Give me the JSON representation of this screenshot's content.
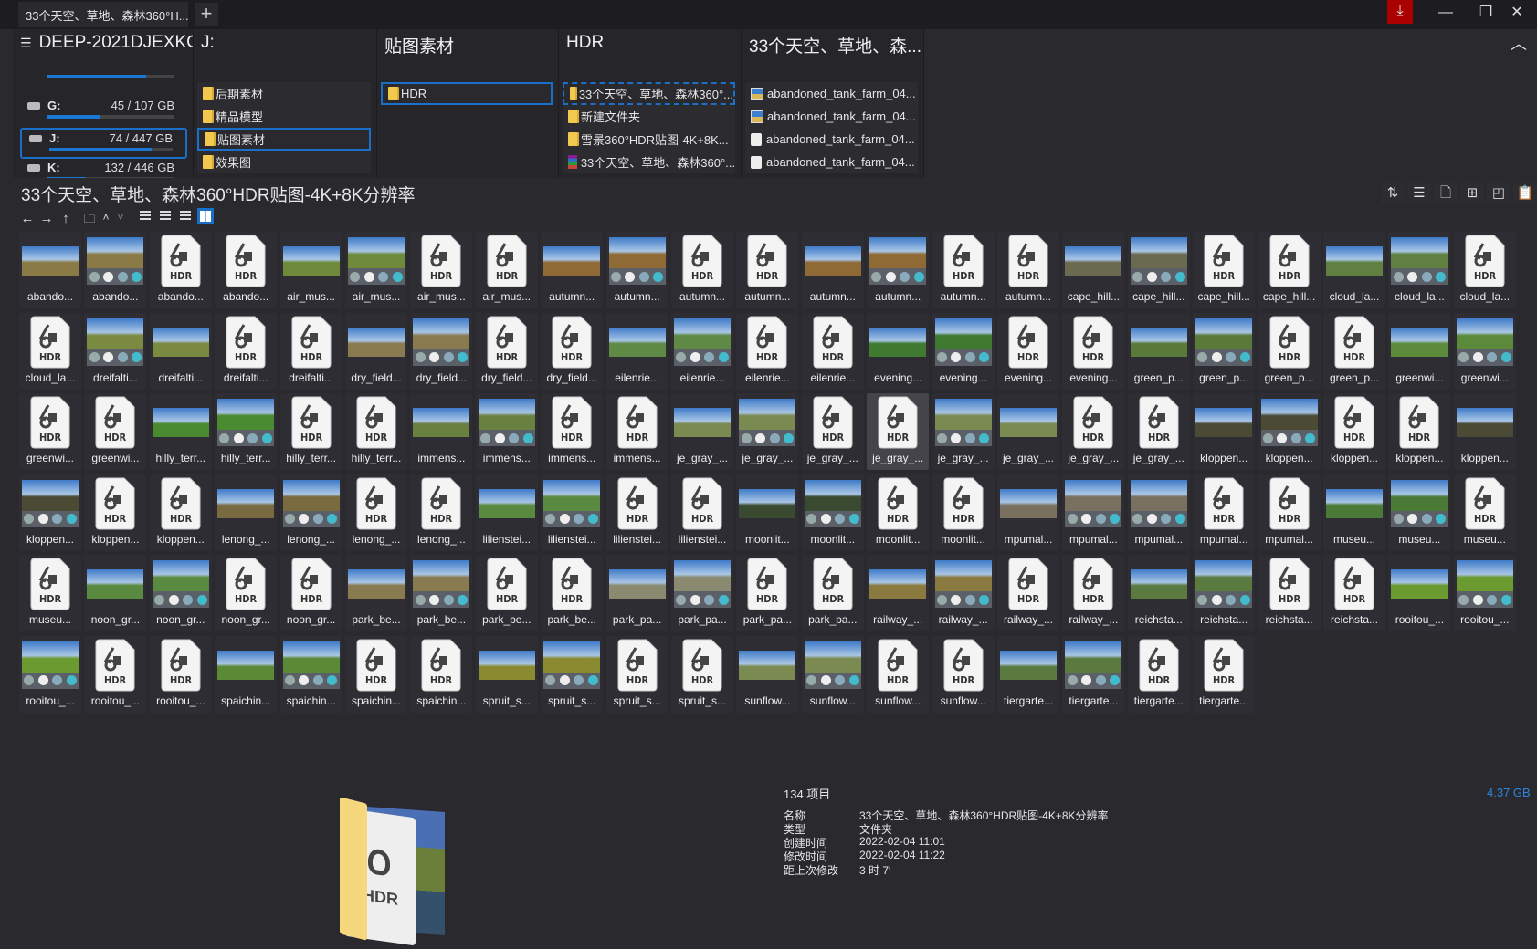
{
  "tab": {
    "title": "33个天空、草地、森林360°H...",
    "new_tab": "+"
  },
  "window": {
    "download": "⤓",
    "minimize": "—",
    "restore": "❐",
    "close": "✕",
    "collapse": "︿"
  },
  "columns": [
    {
      "header": "DEEP-2021DJEXKC",
      "menu_icon": "☰",
      "drives": [
        {
          "name": "G:",
          "size": "45 / 107 GB",
          "used": 0.42
        },
        {
          "name": "J:",
          "size": "74 / 447 GB",
          "used": 0.83,
          "selected": true
        },
        {
          "name": "K:",
          "size": "132 / 446 GB",
          "used": 0.3
        }
      ]
    },
    {
      "header": "J:",
      "items": [
        {
          "label": "后期素材"
        },
        {
          "label": "精品模型"
        },
        {
          "label": "贴图素材",
          "selected": true
        },
        {
          "label": "效果图"
        }
      ]
    },
    {
      "header": "贴图素材",
      "items": [
        {
          "label": "HDR",
          "selected": true
        }
      ]
    },
    {
      "header": "HDR",
      "items": [
        {
          "label": "33个天空、草地、森林360°...",
          "selected": true,
          "icon": "folder"
        },
        {
          "label": "新建文件夹",
          "icon": "folder"
        },
        {
          "label": "雪景360°HDR贴图-4K+8K...",
          "icon": "folder"
        },
        {
          "label": "33个天空、草地、森林360°...",
          "icon": "archive"
        }
      ]
    },
    {
      "header": "33个天空、草地、森...",
      "items": [
        {
          "label": "abandoned_tank_farm_04...",
          "icon": "image"
        },
        {
          "label": "abandoned_tank_farm_04...",
          "icon": "image"
        },
        {
          "label": "abandoned_tank_farm_04...",
          "icon": "hdr-file"
        },
        {
          "label": "abandoned_tank_farm_04...",
          "icon": "hdr-file"
        }
      ]
    }
  ],
  "folder_title": "33个天空、草地、森林360°HDR贴图-4K+8K分辨率",
  "nav_tools": [
    "←",
    "→",
    "↑",
    "🗀",
    "˄",
    "˅"
  ],
  "view_tools": [
    "details",
    "tiles",
    "list",
    "icons"
  ],
  "active_view": "icons",
  "right_tools": [
    "⇅",
    "☰",
    "🗋",
    "⊞",
    "◰",
    "📋"
  ],
  "hdr_label": "HDR",
  "accent": "#1a6fc9",
  "ground_colors": {
    "abando...": "#8a7a45",
    "air_mus...": "#6f8a3a",
    "autumn...": "#8f6a35",
    "cape_hill...": "#6a6a50",
    "cloud_la...": "#5f8040",
    "dreifalti...": "#7a8a40",
    "dry_field...": "#8a7a50",
    "eilenrie...": "#5f8a45",
    "evening...": "#3f7a30",
    "green_p...": "#5a7a3a",
    "greenwi...": "#5a8a3a",
    "hilly_terr...": "#4a8a30",
    "immens...": "#6a8040",
    "je_gray_...": "#7a8a50",
    "kloppen...": "#4a4a35",
    "lenong_...": "#7a6a40",
    "lilienstei...": "#5a8a40",
    "moonlit...": "#3a4a30",
    "mpumal...": "#7a7060",
    "museu...": "#4a7a35",
    "noon_gr...": "#5a8a40",
    "park_be...": "#8a7a50",
    "park_pa...": "#8a8a70",
    "railway_...": "#8a7a40",
    "reichsta...": "#5a7a40",
    "rooitou_...": "#6a9a30",
    "spaichin...": "#5a8a35",
    "spruit_s...": "#8a8a30",
    "sunflow...": "#7a8a50",
    "tiergarte...": "#5a7a40"
  },
  "selected_file_index": 59,
  "files": [
    [
      "abando...",
      "w"
    ],
    [
      "abando...",
      "s"
    ],
    [
      "abando...",
      "h"
    ],
    [
      "abando...",
      "h"
    ],
    [
      "air_mus...",
      "w"
    ],
    [
      "air_mus...",
      "s"
    ],
    [
      "air_mus...",
      "h"
    ],
    [
      "air_mus...",
      "h"
    ],
    [
      "autumn...",
      "w"
    ],
    [
      "autumn...",
      "s"
    ],
    [
      "autumn...",
      "h"
    ],
    [
      "autumn...",
      "h"
    ],
    [
      "autumn...",
      "w"
    ],
    [
      "autumn...",
      "s"
    ],
    [
      "autumn...",
      "h"
    ],
    [
      "autumn...",
      "h"
    ],
    [
      "cape_hill...",
      "w"
    ],
    [
      "cape_hill...",
      "s"
    ],
    [
      "cape_hill...",
      "h"
    ],
    [
      "cape_hill...",
      "h"
    ],
    [
      "cloud_la...",
      "w"
    ],
    [
      "cloud_la...",
      "s"
    ],
    [
      "cloud_la...",
      "h"
    ],
    [
      "cloud_la...",
      "h"
    ],
    [
      "dreifalti...",
      "s"
    ],
    [
      "dreifalti...",
      "w"
    ],
    [
      "dreifalti...",
      "h"
    ],
    [
      "dreifalti...",
      "h"
    ],
    [
      "dry_field...",
      "w"
    ],
    [
      "dry_field...",
      "s"
    ],
    [
      "dry_field...",
      "h"
    ],
    [
      "dry_field...",
      "h"
    ],
    [
      "eilenrie...",
      "w"
    ],
    [
      "eilenrie...",
      "s"
    ],
    [
      "eilenrie...",
      "h"
    ],
    [
      "eilenrie...",
      "h"
    ],
    [
      "evening...",
      "w"
    ],
    [
      "evening...",
      "s"
    ],
    [
      "evening...",
      "h"
    ],
    [
      "evening...",
      "h"
    ],
    [
      "green_p...",
      "w"
    ],
    [
      "green_p...",
      "s"
    ],
    [
      "green_p...",
      "h"
    ],
    [
      "green_p...",
      "h"
    ],
    [
      "greenwi...",
      "w"
    ],
    [
      "greenwi...",
      "s"
    ],
    [
      "greenwi...",
      "h"
    ],
    [
      "greenwi...",
      "h"
    ],
    [
      "hilly_terr...",
      "w"
    ],
    [
      "hilly_terr...",
      "s"
    ],
    [
      "hilly_terr...",
      "h"
    ],
    [
      "hilly_terr...",
      "h"
    ],
    [
      "immens...",
      "w"
    ],
    [
      "immens...",
      "s"
    ],
    [
      "immens...",
      "h"
    ],
    [
      "immens...",
      "h"
    ],
    [
      "je_gray_...",
      "w"
    ],
    [
      "je_gray_...",
      "s"
    ],
    [
      "je_gray_...",
      "h"
    ],
    [
      "je_gray_...",
      "h"
    ],
    [
      "je_gray_...",
      "s"
    ],
    [
      "je_gray_...",
      "w"
    ],
    [
      "je_gray_...",
      "h"
    ],
    [
      "je_gray_...",
      "h"
    ],
    [
      "kloppen...",
      "w"
    ],
    [
      "kloppen...",
      "s"
    ],
    [
      "kloppen...",
      "h"
    ],
    [
      "kloppen...",
      "h"
    ],
    [
      "kloppen...",
      "w"
    ],
    [
      "kloppen...",
      "s"
    ],
    [
      "kloppen...",
      "h"
    ],
    [
      "kloppen...",
      "h"
    ],
    [
      "lenong_...",
      "w"
    ],
    [
      "lenong_...",
      "s"
    ],
    [
      "lenong_...",
      "h"
    ],
    [
      "lenong_...",
      "h"
    ],
    [
      "lilienstei...",
      "w"
    ],
    [
      "lilienstei...",
      "s"
    ],
    [
      "lilienstei...",
      "h"
    ],
    [
      "lilienstei...",
      "h"
    ],
    [
      "moonlit...",
      "w"
    ],
    [
      "moonlit...",
      "s"
    ],
    [
      "moonlit...",
      "h"
    ],
    [
      "moonlit...",
      "h"
    ],
    [
      "mpumal...",
      "w"
    ],
    [
      "mpumal...",
      "s"
    ],
    [
      "mpumal...",
      "s"
    ],
    [
      "mpumal...",
      "h"
    ],
    [
      "mpumal...",
      "h"
    ],
    [
      "museu...",
      "w"
    ],
    [
      "museu...",
      "s"
    ],
    [
      "museu...",
      "h"
    ],
    [
      "museu...",
      "h"
    ],
    [
      "noon_gr...",
      "w"
    ],
    [
      "noon_gr...",
      "s"
    ],
    [
      "noon_gr...",
      "h"
    ],
    [
      "noon_gr...",
      "h"
    ],
    [
      "park_be...",
      "w"
    ],
    [
      "park_be...",
      "s"
    ],
    [
      "park_be...",
      "h"
    ],
    [
      "park_be...",
      "h"
    ],
    [
      "park_pa...",
      "w"
    ],
    [
      "park_pa...",
      "s"
    ],
    [
      "park_pa...",
      "h"
    ],
    [
      "park_pa...",
      "h"
    ],
    [
      "railway_...",
      "w"
    ],
    [
      "railway_...",
      "s"
    ],
    [
      "railway_...",
      "h"
    ],
    [
      "railway_...",
      "h"
    ],
    [
      "reichsta...",
      "w"
    ],
    [
      "reichsta...",
      "s"
    ],
    [
      "reichsta...",
      "h"
    ],
    [
      "reichsta...",
      "h"
    ],
    [
      "rooitou_...",
      "w"
    ],
    [
      "rooitou_...",
      "s"
    ],
    [
      "rooitou_...",
      "s"
    ],
    [
      "rooitou_...",
      "h"
    ],
    [
      "rooitou_...",
      "h"
    ],
    [
      "spaichin...",
      "w"
    ],
    [
      "spaichin...",
      "s"
    ],
    [
      "spaichin...",
      "h"
    ],
    [
      "spaichin...",
      "h"
    ],
    [
      "spruit_s...",
      "w"
    ],
    [
      "spruit_s...",
      "s"
    ],
    [
      "spruit_s...",
      "h"
    ],
    [
      "spruit_s...",
      "h"
    ],
    [
      "sunflow...",
      "w"
    ],
    [
      "sunflow...",
      "s"
    ],
    [
      "sunflow...",
      "h"
    ],
    [
      "sunflow...",
      "h"
    ],
    [
      "tiergarte...",
      "w"
    ],
    [
      "tiergarte...",
      "s"
    ],
    [
      "tiergarte...",
      "h"
    ],
    [
      "tiergarte...",
      "h"
    ]
  ],
  "info": {
    "count": "134 项目",
    "total_size": "4.37 GB",
    "rows": [
      {
        "key": "名称",
        "value": "33个天空、草地、森林360°HDR贴图-4K+8K分辨率"
      },
      {
        "key": "类型",
        "value": "文件夹"
      },
      {
        "key": "创建时间",
        "value": "2022-02-04  11:01"
      },
      {
        "key": "修改时间",
        "value": "2022-02-04  11:22"
      },
      {
        "key": "距上次修改",
        "value": "3 时 7′"
      }
    ]
  }
}
